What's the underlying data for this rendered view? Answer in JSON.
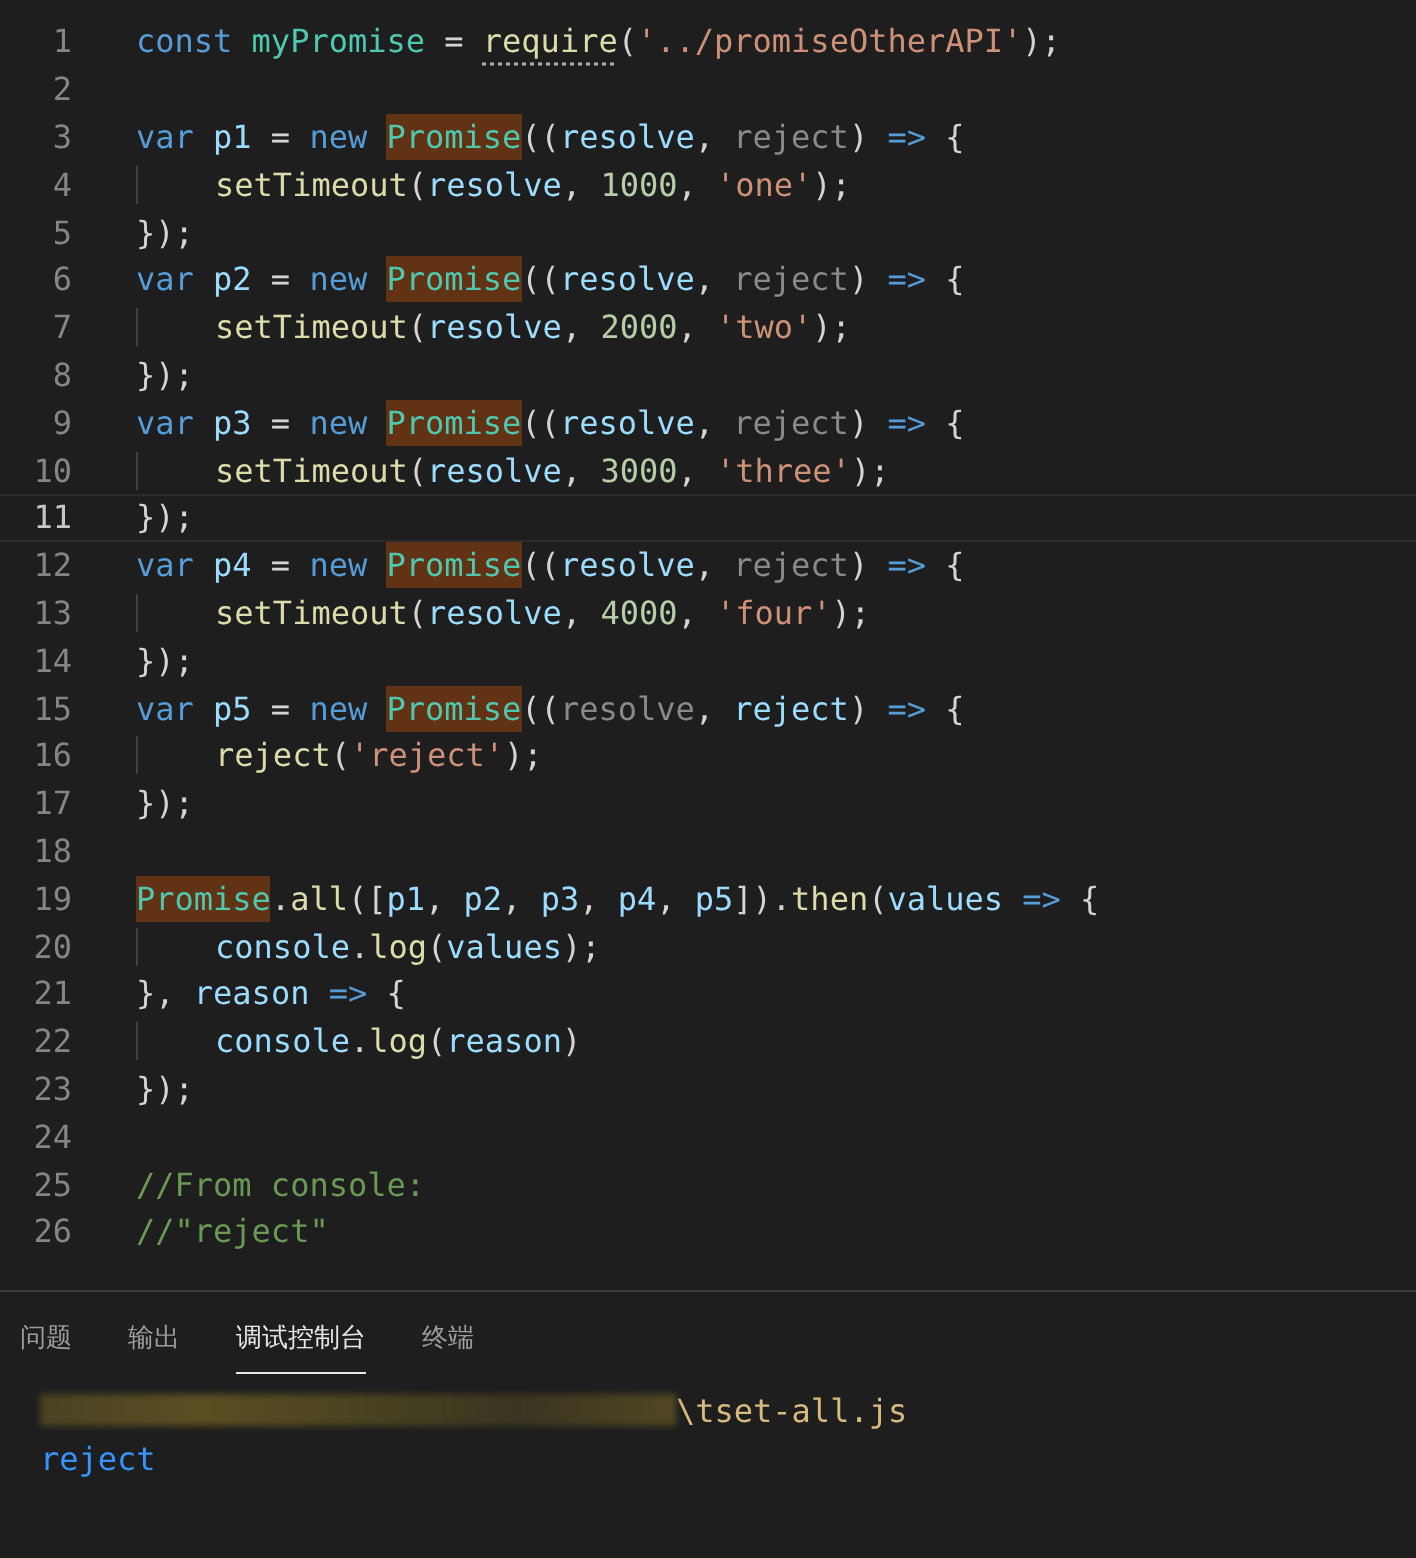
{
  "editor": {
    "lines": [
      {
        "number": "1",
        "current": false,
        "indented": false,
        "tokens": [
          {
            "kind": "keyword",
            "text": "const "
          },
          {
            "kind": "constant",
            "text": "myPromise"
          },
          {
            "kind": "punct",
            "text": " = "
          },
          {
            "kind": "function-hint",
            "text": "require"
          },
          {
            "kind": "punct",
            "text": "("
          },
          {
            "kind": "string",
            "text": "'../promiseOtherAPI'"
          },
          {
            "kind": "punct",
            "text": ");"
          }
        ]
      },
      {
        "number": "2",
        "current": false
      },
      {
        "number": "3",
        "current": false,
        "indented": false,
        "tokens": [
          {
            "kind": "keyword",
            "text": "var "
          },
          {
            "kind": "variable",
            "text": "p1"
          },
          {
            "kind": "punct",
            "text": " = "
          },
          {
            "kind": "keyword",
            "text": "new "
          },
          {
            "kind": "match",
            "text": "Promise"
          },
          {
            "kind": "punct",
            "text": "(("
          },
          {
            "kind": "variable",
            "text": "resolve"
          },
          {
            "kind": "punct",
            "text": ", "
          },
          {
            "kind": "unused",
            "text": "reject"
          },
          {
            "kind": "punct",
            "text": ") "
          },
          {
            "kind": "keyword",
            "text": "=>"
          },
          {
            "kind": "punct",
            "text": " {"
          }
        ]
      },
      {
        "number": "4",
        "current": false,
        "indented": true,
        "tokens": [
          {
            "kind": "function",
            "text": "setTimeout"
          },
          {
            "kind": "punct",
            "text": "("
          },
          {
            "kind": "variable",
            "text": "resolve"
          },
          {
            "kind": "punct",
            "text": ", "
          },
          {
            "kind": "number",
            "text": "1000"
          },
          {
            "kind": "punct",
            "text": ", "
          },
          {
            "kind": "string",
            "text": "'one'"
          },
          {
            "kind": "punct",
            "text": ");"
          }
        ]
      },
      {
        "number": "5",
        "current": false,
        "indented": false,
        "tokens": [
          {
            "kind": "punct",
            "text": "});"
          }
        ]
      },
      {
        "number": "6",
        "current": false,
        "indented": false,
        "tokens": [
          {
            "kind": "keyword",
            "text": "var "
          },
          {
            "kind": "variable",
            "text": "p2"
          },
          {
            "kind": "punct",
            "text": " = "
          },
          {
            "kind": "keyword",
            "text": "new "
          },
          {
            "kind": "match",
            "text": "Promise"
          },
          {
            "kind": "punct",
            "text": "(("
          },
          {
            "kind": "variable",
            "text": "resolve"
          },
          {
            "kind": "punct",
            "text": ", "
          },
          {
            "kind": "unused",
            "text": "reject"
          },
          {
            "kind": "punct",
            "text": ") "
          },
          {
            "kind": "keyword",
            "text": "=>"
          },
          {
            "kind": "punct",
            "text": " {"
          }
        ]
      },
      {
        "number": "7",
        "current": false,
        "indented": true,
        "tokens": [
          {
            "kind": "function",
            "text": "setTimeout"
          },
          {
            "kind": "punct",
            "text": "("
          },
          {
            "kind": "variable",
            "text": "resolve"
          },
          {
            "kind": "punct",
            "text": ", "
          },
          {
            "kind": "number",
            "text": "2000"
          },
          {
            "kind": "punct",
            "text": ", "
          },
          {
            "kind": "string",
            "text": "'two'"
          },
          {
            "kind": "punct",
            "text": ");"
          }
        ]
      },
      {
        "number": "8",
        "current": false,
        "indented": false,
        "tokens": [
          {
            "kind": "punct",
            "text": "});"
          }
        ]
      },
      {
        "number": "9",
        "current": false,
        "indented": false,
        "tokens": [
          {
            "kind": "keyword",
            "text": "var "
          },
          {
            "kind": "variable",
            "text": "p3"
          },
          {
            "kind": "punct",
            "text": " = "
          },
          {
            "kind": "keyword",
            "text": "new "
          },
          {
            "kind": "match",
            "text": "Promise"
          },
          {
            "kind": "punct",
            "text": "(("
          },
          {
            "kind": "variable",
            "text": "resolve"
          },
          {
            "kind": "punct",
            "text": ", "
          },
          {
            "kind": "unused",
            "text": "reject"
          },
          {
            "kind": "punct",
            "text": ") "
          },
          {
            "kind": "keyword",
            "text": "=>"
          },
          {
            "kind": "punct",
            "text": " {"
          }
        ]
      },
      {
        "number": "10",
        "current": false,
        "indented": true,
        "tokens": [
          {
            "kind": "function",
            "text": "setTimeout"
          },
          {
            "kind": "punct",
            "text": "("
          },
          {
            "kind": "variable",
            "text": "resolve"
          },
          {
            "kind": "punct",
            "text": ", "
          },
          {
            "kind": "number",
            "text": "3000"
          },
          {
            "kind": "punct",
            "text": ", "
          },
          {
            "kind": "string",
            "text": "'three'"
          },
          {
            "kind": "punct",
            "text": ");"
          }
        ]
      },
      {
        "number": "11",
        "current": true,
        "indented": false,
        "tokens": [
          {
            "kind": "punct",
            "text": "});"
          }
        ]
      },
      {
        "number": "12",
        "current": false,
        "indented": false,
        "tokens": [
          {
            "kind": "keyword",
            "text": "var "
          },
          {
            "kind": "variable",
            "text": "p4"
          },
          {
            "kind": "punct",
            "text": " = "
          },
          {
            "kind": "keyword",
            "text": "new "
          },
          {
            "kind": "match",
            "text": "Promise"
          },
          {
            "kind": "punct",
            "text": "(("
          },
          {
            "kind": "variable",
            "text": "resolve"
          },
          {
            "kind": "punct",
            "text": ", "
          },
          {
            "kind": "unused",
            "text": "reject"
          },
          {
            "kind": "punct",
            "text": ") "
          },
          {
            "kind": "keyword",
            "text": "=>"
          },
          {
            "kind": "punct",
            "text": " {"
          }
        ]
      },
      {
        "number": "13",
        "current": false,
        "indented": true,
        "tokens": [
          {
            "kind": "function",
            "text": "setTimeout"
          },
          {
            "kind": "punct",
            "text": "("
          },
          {
            "kind": "variable",
            "text": "resolve"
          },
          {
            "kind": "punct",
            "text": ", "
          },
          {
            "kind": "number",
            "text": "4000"
          },
          {
            "kind": "punct",
            "text": ", "
          },
          {
            "kind": "string",
            "text": "'four'"
          },
          {
            "kind": "punct",
            "text": ");"
          }
        ]
      },
      {
        "number": "14",
        "current": false,
        "indented": false,
        "tokens": [
          {
            "kind": "punct",
            "text": "});"
          }
        ]
      },
      {
        "number": "15",
        "current": false,
        "indented": false,
        "tokens": [
          {
            "kind": "keyword",
            "text": "var "
          },
          {
            "kind": "variable",
            "text": "p5"
          },
          {
            "kind": "punct",
            "text": " = "
          },
          {
            "kind": "keyword",
            "text": "new "
          },
          {
            "kind": "match",
            "text": "Promise"
          },
          {
            "kind": "punct",
            "text": "(("
          },
          {
            "kind": "unused",
            "text": "resolve"
          },
          {
            "kind": "punct",
            "text": ", "
          },
          {
            "kind": "variable",
            "text": "reject"
          },
          {
            "kind": "punct",
            "text": ") "
          },
          {
            "kind": "keyword",
            "text": "=>"
          },
          {
            "kind": "punct",
            "text": " {"
          }
        ]
      },
      {
        "number": "16",
        "current": false,
        "indented": true,
        "tokens": [
          {
            "kind": "function",
            "text": "reject"
          },
          {
            "kind": "punct",
            "text": "("
          },
          {
            "kind": "string",
            "text": "'reject'"
          },
          {
            "kind": "punct",
            "text": ");"
          }
        ]
      },
      {
        "number": "17",
        "current": false,
        "indented": false,
        "tokens": [
          {
            "kind": "punct",
            "text": "});"
          }
        ]
      },
      {
        "number": "18",
        "current": false
      },
      {
        "number": "19",
        "current": false,
        "indented": false,
        "tokens": [
          {
            "kind": "match",
            "text": "Promise"
          },
          {
            "kind": "punct",
            "text": "."
          },
          {
            "kind": "function",
            "text": "all"
          },
          {
            "kind": "punct",
            "text": "(["
          },
          {
            "kind": "variable",
            "text": "p1"
          },
          {
            "kind": "punct",
            "text": ", "
          },
          {
            "kind": "variable",
            "text": "p2"
          },
          {
            "kind": "punct",
            "text": ", "
          },
          {
            "kind": "variable",
            "text": "p3"
          },
          {
            "kind": "punct",
            "text": ", "
          },
          {
            "kind": "variable",
            "text": "p4"
          },
          {
            "kind": "punct",
            "text": ", "
          },
          {
            "kind": "variable",
            "text": "p5"
          },
          {
            "kind": "punct",
            "text": "])."
          },
          {
            "kind": "function",
            "text": "then"
          },
          {
            "kind": "punct",
            "text": "("
          },
          {
            "kind": "variable",
            "text": "values "
          },
          {
            "kind": "keyword",
            "text": "=>"
          },
          {
            "kind": "punct",
            "text": " {"
          }
        ]
      },
      {
        "number": "20",
        "current": false,
        "indented": true,
        "tokens": [
          {
            "kind": "variable",
            "text": "console"
          },
          {
            "kind": "punct",
            "text": "."
          },
          {
            "kind": "function",
            "text": "log"
          },
          {
            "kind": "punct",
            "text": "("
          },
          {
            "kind": "variable",
            "text": "values"
          },
          {
            "kind": "punct",
            "text": ");"
          }
        ]
      },
      {
        "number": "21",
        "current": false,
        "indented": false,
        "tokens": [
          {
            "kind": "punct",
            "text": "}, "
          },
          {
            "kind": "variable",
            "text": "reason "
          },
          {
            "kind": "keyword",
            "text": "=>"
          },
          {
            "kind": "punct",
            "text": " {"
          }
        ]
      },
      {
        "number": "22",
        "current": false,
        "indented": true,
        "tokens": [
          {
            "kind": "variable",
            "text": "console"
          },
          {
            "kind": "punct",
            "text": "."
          },
          {
            "kind": "function",
            "text": "log"
          },
          {
            "kind": "punct",
            "text": "("
          },
          {
            "kind": "variable",
            "text": "reason"
          },
          {
            "kind": "punct",
            "text": ")"
          }
        ]
      },
      {
        "number": "23",
        "current": false,
        "indented": false,
        "tokens": [
          {
            "kind": "punct",
            "text": "});"
          }
        ]
      },
      {
        "number": "24",
        "current": false
      },
      {
        "number": "25",
        "current": false,
        "indented": false,
        "tokens": [
          {
            "kind": "comment",
            "text": "//From console:"
          }
        ]
      },
      {
        "number": "26",
        "current": false,
        "indented": false,
        "tokens": [
          {
            "kind": "comment",
            "text": "//\"reject\""
          }
        ]
      }
    ]
  },
  "panel": {
    "tabs": [
      {
        "label": "问题",
        "selected": false
      },
      {
        "label": "输出",
        "selected": false
      },
      {
        "label": "调试控制台",
        "selected": true
      },
      {
        "label": "终端",
        "selected": false
      }
    ],
    "console_lines": [
      {
        "kind": "path",
        "text": "\\tset-all.js"
      },
      {
        "kind": "output",
        "text": "reject"
      }
    ]
  }
}
